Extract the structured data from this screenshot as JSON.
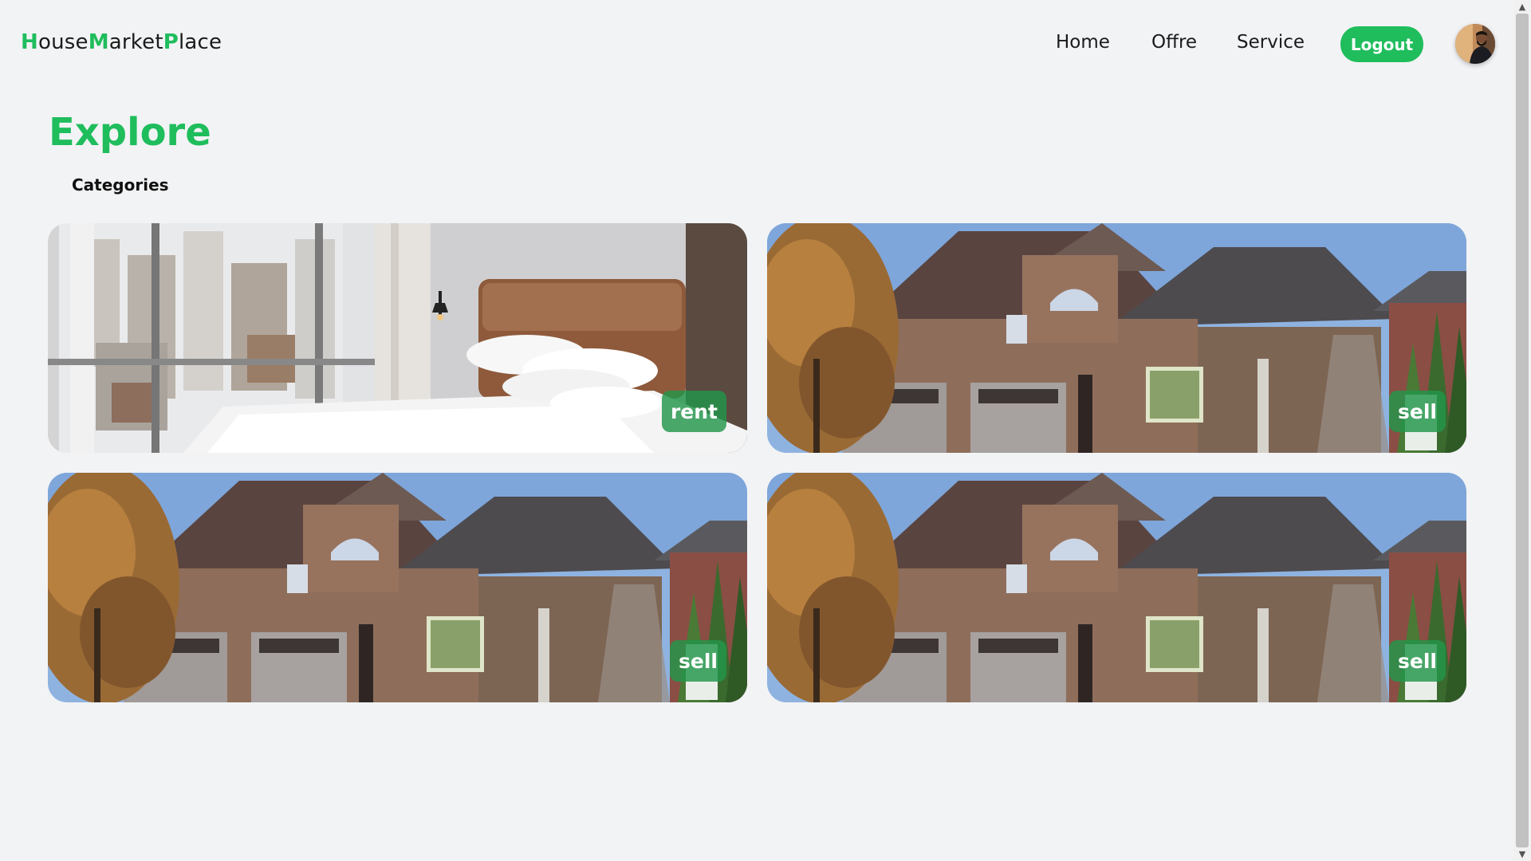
{
  "brand": {
    "part1_accent": "H",
    "part1_rest": "ouse",
    "part2_accent": "M",
    "part2_rest": "arket",
    "part3_accent": "P",
    "part3_rest": "lace",
    "accent_color": "#1fbd5c"
  },
  "nav": {
    "home": "Home",
    "offre": "Offre",
    "service": "Service",
    "logout": "Logout"
  },
  "page": {
    "title": "Explore",
    "section": "Categories"
  },
  "cards": [
    {
      "type": "rent",
      "image": "bedroom-photo"
    },
    {
      "type": "sell",
      "image": "house-photo"
    },
    {
      "type": "sell",
      "image": "house-photo"
    },
    {
      "type": "sell",
      "image": "house-photo"
    }
  ],
  "scrollbar": {
    "up_icon": "chevron-up-icon",
    "down_icon": "chevron-down-icon"
  }
}
